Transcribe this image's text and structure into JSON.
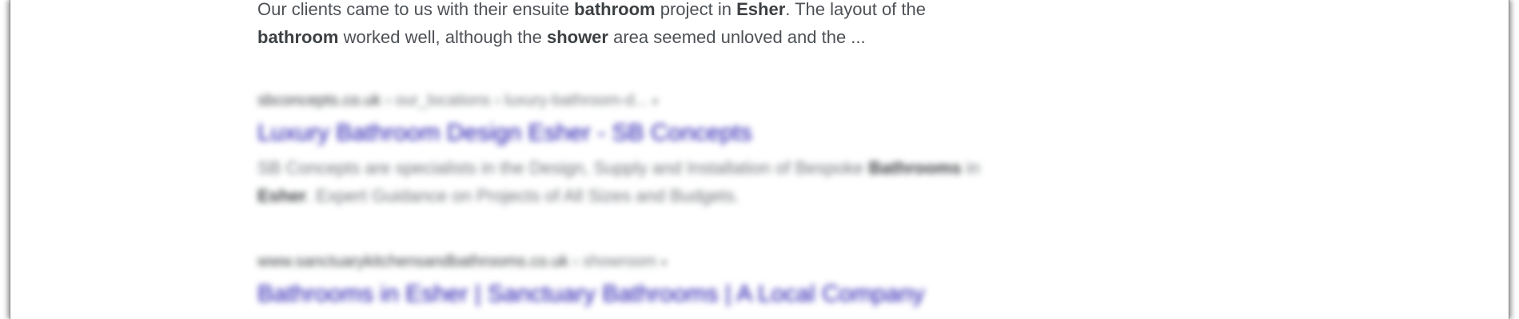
{
  "results": [
    {
      "snippet_parts": [
        {
          "text": "Our clients came to us with their ensuite ",
          "bold": false
        },
        {
          "text": "bathroom",
          "bold": true
        },
        {
          "text": " project in ",
          "bold": false
        },
        {
          "text": "Esher",
          "bold": true
        },
        {
          "text": ". The layout of the ",
          "bold": false
        },
        {
          "text": "bathroom",
          "bold": true
        },
        {
          "text": " worked well, although the ",
          "bold": false
        },
        {
          "text": "shower",
          "bold": true
        },
        {
          "text": " area seemed unloved and the ...",
          "bold": false
        }
      ]
    },
    {
      "domain": "sbconcepts.co.uk",
      "path": " › our_locations › luxury-bathroom-d...",
      "arrow": "▾",
      "title": "Luxury Bathroom Design Esher - SB Concepts",
      "snippet_parts": [
        {
          "text": "SB Concepts are specialists in the Design, Supply and Installation of Bespoke ",
          "bold": false
        },
        {
          "text": "Bathrooms",
          "bold": true
        },
        {
          "text": " in ",
          "bold": false
        },
        {
          "text": "Esher",
          "bold": true
        },
        {
          "text": ". Expert Guidance on Projects of All Sizes and Budgets.",
          "bold": false
        }
      ]
    },
    {
      "domain": "www.sanctuarykitchensandbathrooms.co.uk",
      "path": " › showroom",
      "arrow": "▾",
      "title": "Bathrooms in Esher | Sanctuary Bathrooms | A Local Company"
    }
  ],
  "colors": {
    "link": "#1a0dab",
    "snippet": "#4d5156",
    "cite": "#70757a"
  }
}
